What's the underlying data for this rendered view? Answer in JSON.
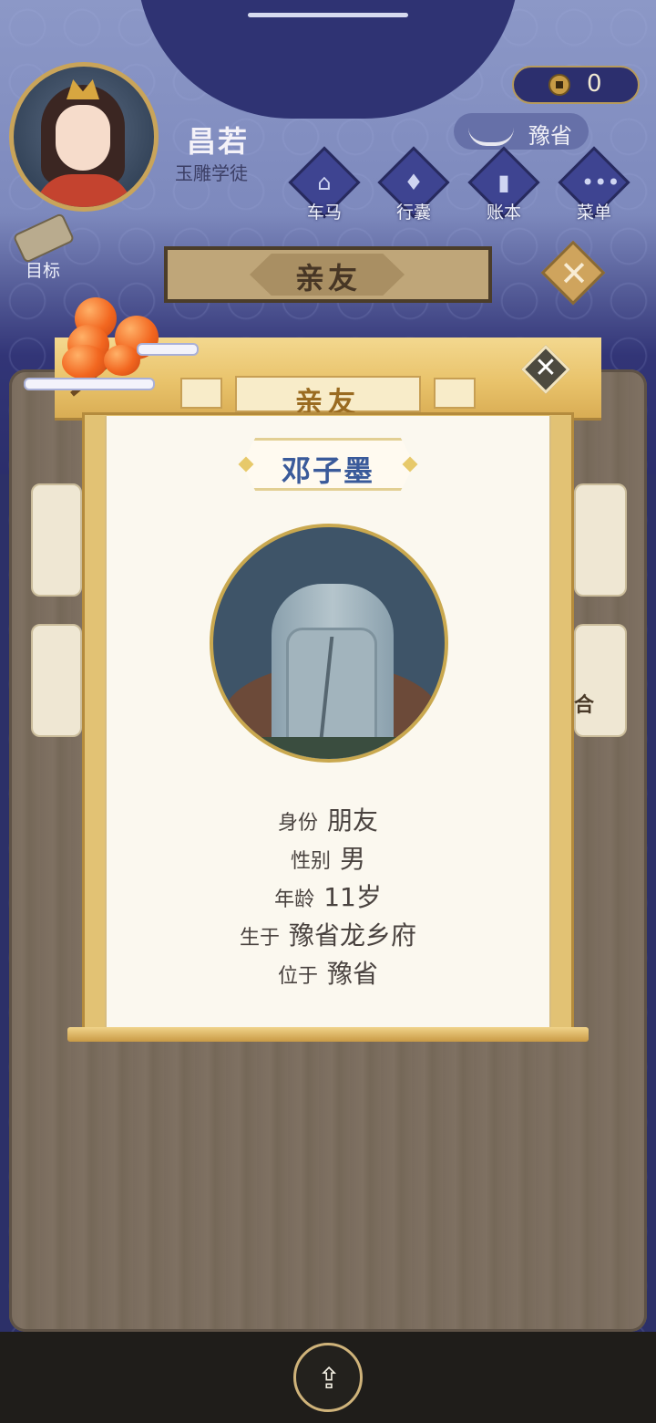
{
  "player": {
    "name": "昌若",
    "title": "玉雕学徒"
  },
  "currency": {
    "coins": "0"
  },
  "location": {
    "label": "豫省"
  },
  "menu": [
    {
      "label": "车马",
      "icon": "carriage-icon"
    },
    {
      "label": "行囊",
      "icon": "bag-icon"
    },
    {
      "label": "账本",
      "icon": "ledger-icon"
    },
    {
      "label": "菜单",
      "icon": "more-icon"
    }
  ],
  "goal": {
    "label": "目标"
  },
  "banner": {
    "title": "亲友"
  },
  "background_list": {
    "card_text": "合"
  },
  "modal": {
    "header": "亲友",
    "name": "邓子墨",
    "info": [
      {
        "key": "身份",
        "value": "朋友"
      },
      {
        "key": "性别",
        "value": "男"
      },
      {
        "key": "年龄",
        "value": "11岁"
      },
      {
        "key": "生于",
        "value": "豫省龙乡府"
      },
      {
        "key": "位于",
        "value": "豫省"
      }
    ],
    "close_icon": "close-icon"
  },
  "bottom": {
    "share_icon": "share-icon"
  },
  "colors": {
    "accent_gold": "#e2c274",
    "name_blue": "#3a5a9a",
    "wood": "#7a6c5e"
  }
}
